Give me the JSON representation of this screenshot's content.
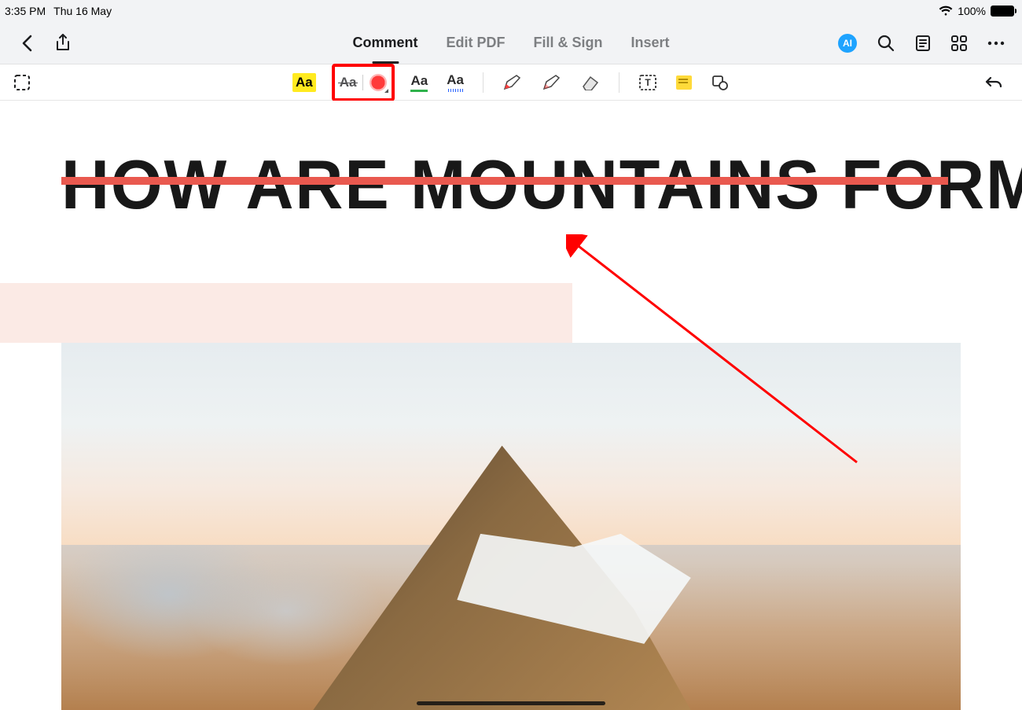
{
  "status_bar": {
    "time": "3:35 PM",
    "date": "Thu 16 May",
    "battery_percent": "100%"
  },
  "topbar": {
    "tabs": {
      "comment": "Comment",
      "edit_pdf": "Edit PDF",
      "fill_sign": "Fill & Sign",
      "insert": "Insert"
    },
    "ai_label": "AI"
  },
  "toolbar": {
    "highlight_sample": "Aa",
    "strike_sample": "Aa",
    "underline_sample": "Aa",
    "squiggle_sample": "Aa"
  },
  "document": {
    "title_text": "HOW ARE MOUNTAINS FORMED?"
  }
}
